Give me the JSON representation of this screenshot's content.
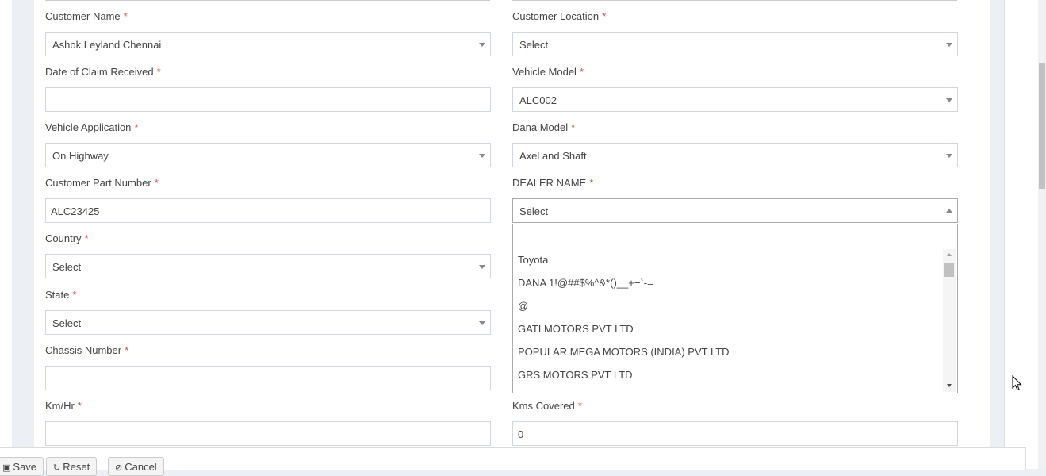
{
  "form": {
    "customer_name": {
      "label": "Customer Name",
      "value": "Ashok Leyland Chennai"
    },
    "customer_location": {
      "label": "Customer Location",
      "value": "Select"
    },
    "date_of_claim": {
      "label": "Date of Claim Received",
      "value": ""
    },
    "vehicle_model": {
      "label": "Vehicle Model",
      "value": "ALC002"
    },
    "vehicle_application": {
      "label": "Vehicle Application",
      "value": "On Highway"
    },
    "dana_model": {
      "label": "Dana Model",
      "value": "Axel and Shaft"
    },
    "customer_part_number": {
      "label": "Customer Part Number",
      "value": "ALC23425"
    },
    "dealer_name": {
      "label": "DEALER NAME",
      "value": "Select"
    },
    "country": {
      "label": "Country",
      "value": "Select"
    },
    "state": {
      "label": "State",
      "value": "Select"
    },
    "chassis_number": {
      "label": "Chassis Number",
      "value": ""
    },
    "km_hr": {
      "label": "Km/Hr",
      "value": ""
    },
    "kms_covered": {
      "label": "Kms Covered",
      "value": "0"
    },
    "required_marker": "*"
  },
  "dealer_dropdown": {
    "search_value": "",
    "options": [
      "Toyota",
      "DANA 1!@##$%^&*()__+−`-=",
      "@",
      "GATI MOTORS PVT LTD",
      "POPULAR MEGA MOTORS (INDIA) PVT LTD",
      "GRS MOTORS PVT LTD"
    ]
  },
  "footer": {
    "save_label": "Save",
    "reset_label": "Reset",
    "cancel_label": "Cancel",
    "save_icon": "floppy-icon",
    "reset_icon": "refresh-icon",
    "cancel_icon": "ban-icon"
  },
  "colors": {
    "required": "#dd4b39",
    "border": "#d2d6de",
    "page_bg": "#ecf0f5"
  }
}
